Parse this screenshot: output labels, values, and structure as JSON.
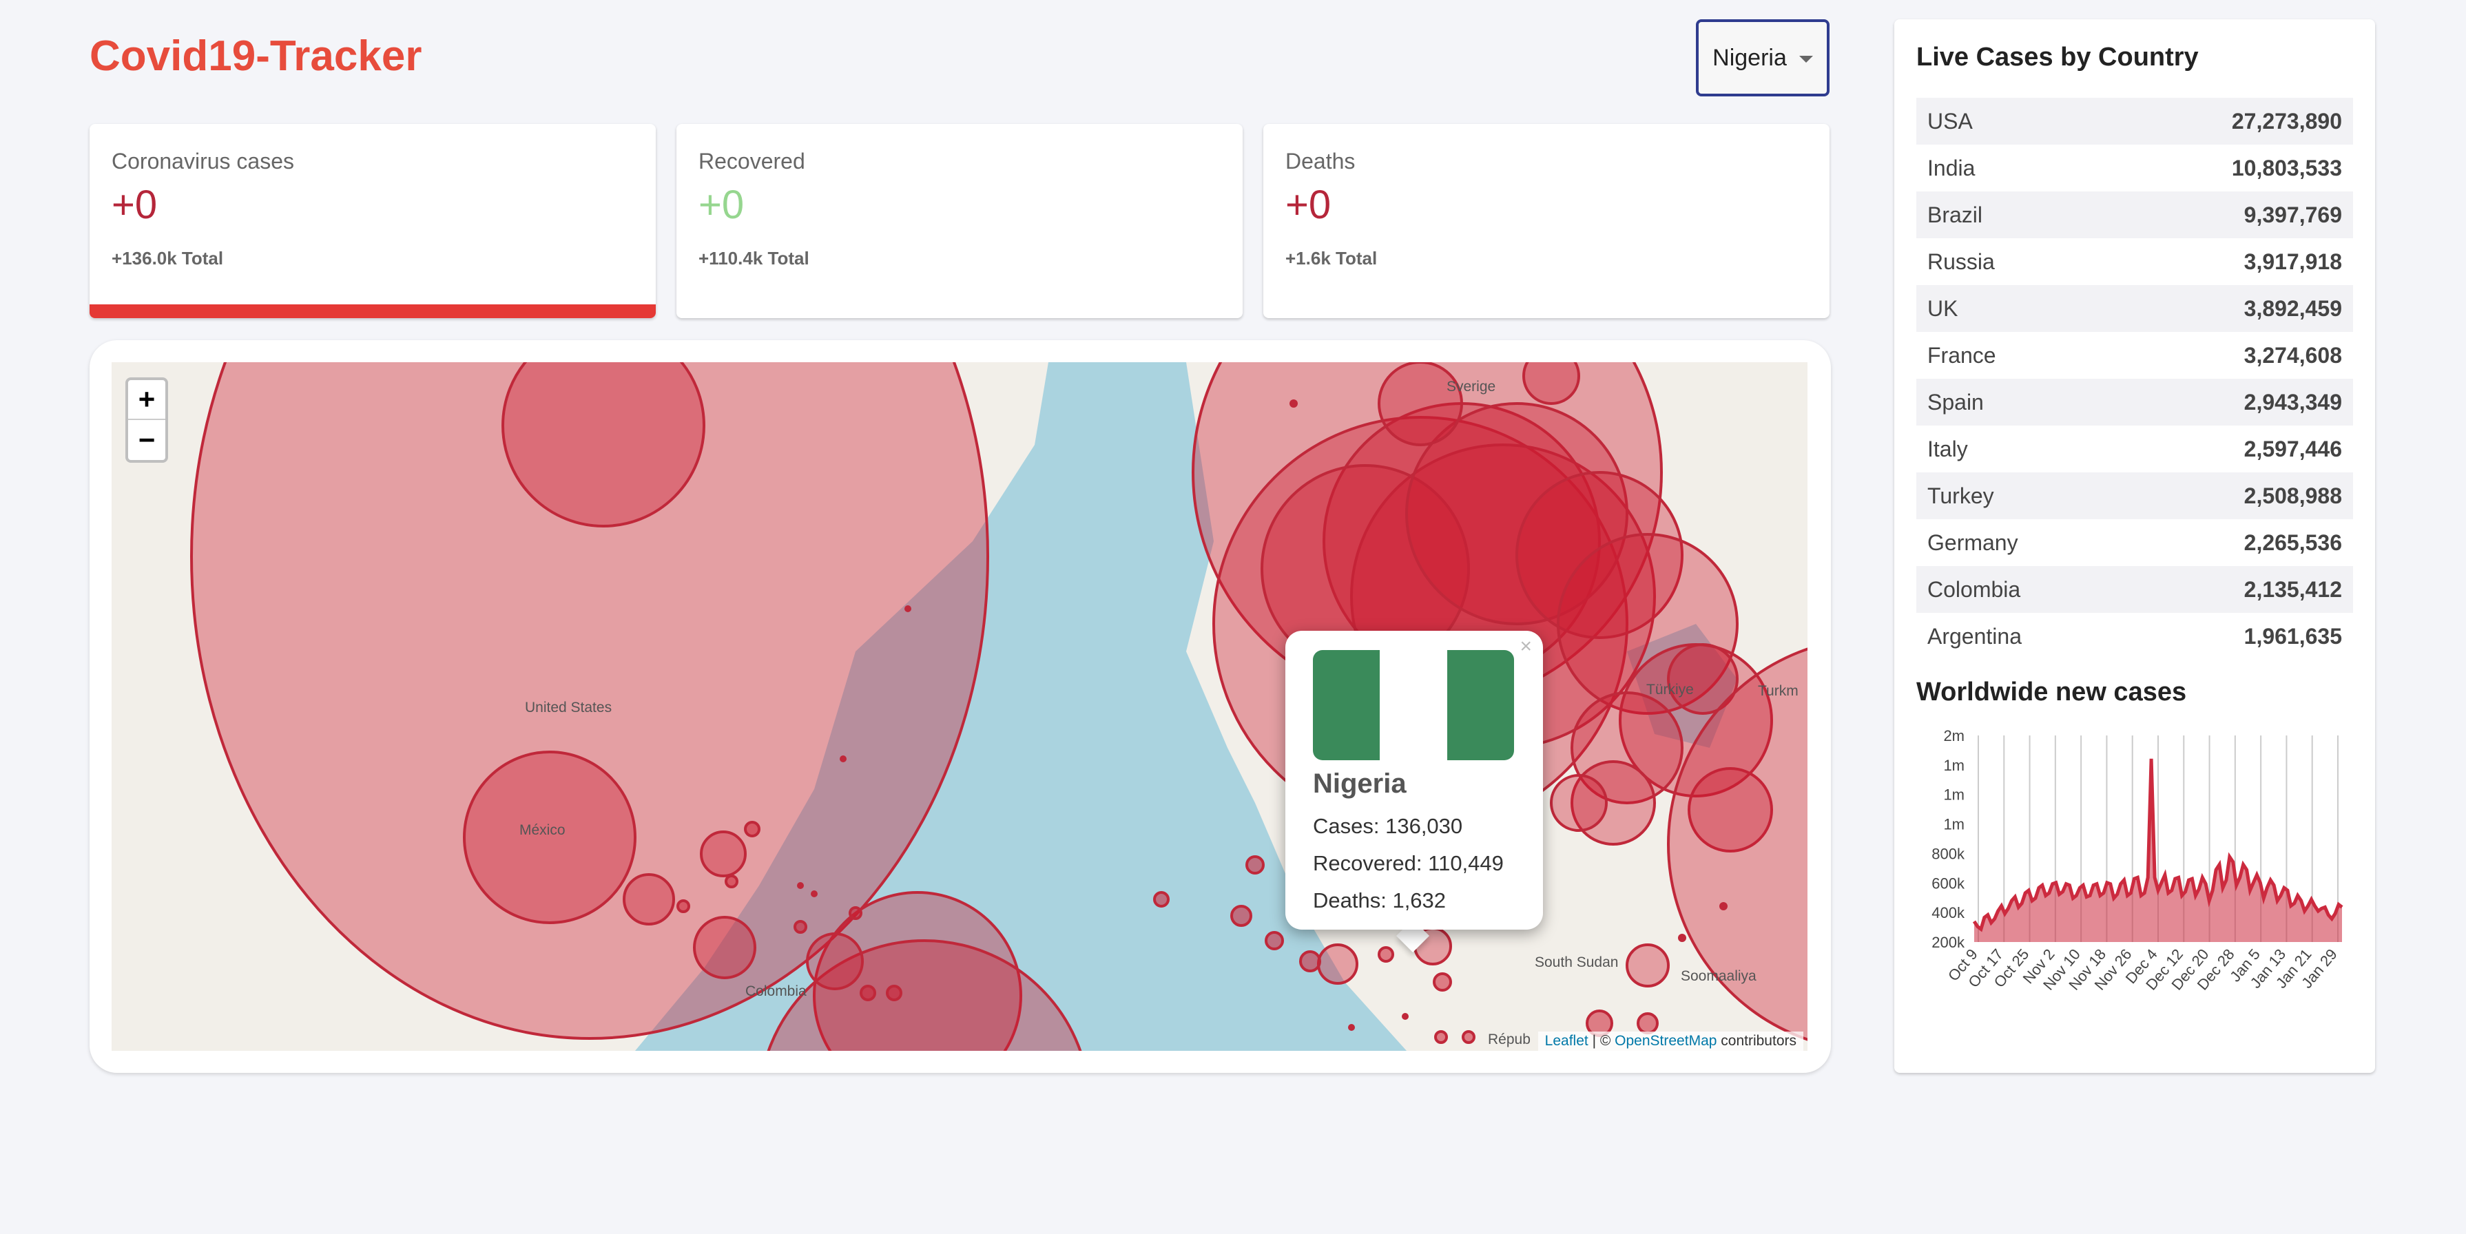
{
  "app": {
    "title": "Covid19-Tracker"
  },
  "country_select": {
    "selected": "Nigeria",
    "icon": "caret-down-icon"
  },
  "cards": [
    {
      "title": "Coronavirus cases",
      "value": "+0",
      "total": "+136.0k Total",
      "value_color": "#b5263a",
      "active": true
    },
    {
      "title": "Recovered",
      "value": "+0",
      "total": "+110.4k Total",
      "value_color": "#96d68f",
      "active": false
    },
    {
      "title": "Deaths",
      "value": "+0",
      "total": "+1.6k Total",
      "value_color": "#b5263a",
      "active": false
    }
  ],
  "map": {
    "zoom_in": "+",
    "zoom_out": "−",
    "labels": {
      "united_states": "United States",
      "mexico": "México",
      "colombia": "Colombia",
      "sverige": "Sverige",
      "turkiye": "Türkiye",
      "south_sudan": "South Sudan",
      "somaaliya": "Soomaaliya",
      "repub": "Répub",
      "turkm": "Turkm"
    },
    "attribution": {
      "leaflet": "Leaflet",
      "sep": " | © ",
      "osm": "OpenStreetMap",
      "contributors": " contributors"
    },
    "popup": {
      "close": "×",
      "country": "Nigeria",
      "cases": "Cases: 136,030",
      "recovered": "Recovered: 110,449",
      "deaths": "Deaths: 1,632",
      "flag_colors": [
        "#3a8a5a",
        "#ffffff",
        "#3a8a5a"
      ]
    }
  },
  "sidebar": {
    "title": "Live Cases by Country",
    "countries": [
      {
        "name": "USA",
        "cases": "27,273,890"
      },
      {
        "name": "India",
        "cases": "10,803,533"
      },
      {
        "name": "Brazil",
        "cases": "9,397,769"
      },
      {
        "name": "Russia",
        "cases": "3,917,918"
      },
      {
        "name": "UK",
        "cases": "3,892,459"
      },
      {
        "name": "France",
        "cases": "3,274,608"
      },
      {
        "name": "Spain",
        "cases": "2,943,349"
      },
      {
        "name": "Italy",
        "cases": "2,597,446"
      },
      {
        "name": "Turkey",
        "cases": "2,508,988"
      },
      {
        "name": "Germany",
        "cases": "2,265,536"
      },
      {
        "name": "Colombia",
        "cases": "2,135,412"
      },
      {
        "name": "Argentina",
        "cases": "1,961,635"
      }
    ],
    "chart_title": "Worldwide new cases"
  },
  "colors": {
    "accent": "#e74c3c",
    "circle_fill": "rgba(204,30,50,0.38)",
    "circle_stroke": "#c0283a",
    "chart_line": "#cc2a3e",
    "chart_fill": "rgba(204,42,62,0.55)"
  },
  "chart_data": {
    "type": "area",
    "title": "",
    "xlabel": "",
    "ylabel": "",
    "ytick_labels": [
      "200k",
      "400k",
      "600k",
      "800k",
      "1m",
      "1m",
      "1m",
      "2m"
    ],
    "ylim": [
      200000,
      1800000
    ],
    "xtick_labels": [
      "Oct 9",
      "Oct 17",
      "Oct 25",
      "Nov 2",
      "Nov 10",
      "Nov 18",
      "Nov 26",
      "Dec 4",
      "Dec 12",
      "Dec 20",
      "Dec 28",
      "Jan 5",
      "Jan 13",
      "Jan 21",
      "Jan 29"
    ],
    "x_start": "Oct 9",
    "x_end": "Feb 3",
    "values": [
      360000,
      320000,
      300000,
      390000,
      410000,
      350000,
      380000,
      440000,
      480000,
      420000,
      460000,
      520000,
      550000,
      470000,
      500000,
      580000,
      600000,
      520000,
      540000,
      620000,
      640000,
      560000,
      580000,
      650000,
      660000,
      570000,
      590000,
      650000,
      640000,
      540000,
      560000,
      620000,
      640000,
      550000,
      560000,
      640000,
      650000,
      560000,
      580000,
      660000,
      650000,
      540000,
      570000,
      650000,
      680000,
      560000,
      580000,
      690000,
      700000,
      560000,
      580000,
      700000,
      1620000,
      700000,
      600000,
      660000,
      720000,
      580000,
      600000,
      690000,
      700000,
      560000,
      590000,
      680000,
      690000,
      560000,
      610000,
      700000,
      650000,
      520000,
      600000,
      760000,
      800000,
      620000,
      680000,
      860000,
      820000,
      640000,
      700000,
      800000,
      760000,
      600000,
      660000,
      720000,
      660000,
      540000,
      620000,
      680000,
      640000,
      520000,
      560000,
      620000,
      600000,
      480000,
      500000,
      560000,
      520000,
      440000,
      480000,
      530000,
      480000,
      440000,
      460000,
      470000,
      410000,
      380000,
      420000,
      490000,
      470000
    ]
  }
}
